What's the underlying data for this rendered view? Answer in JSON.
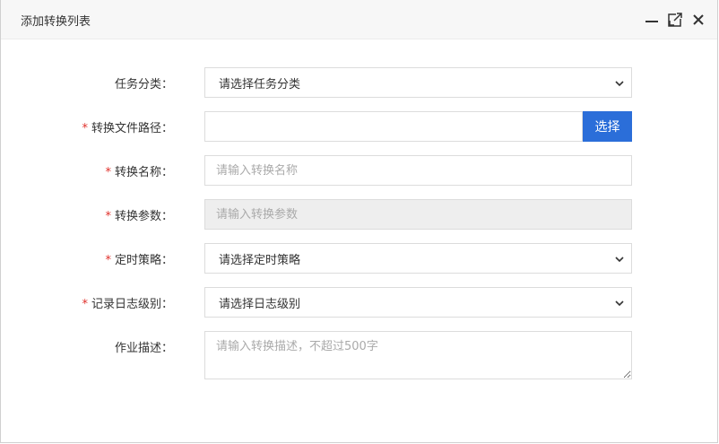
{
  "dialog": {
    "title": "添加转换列表"
  },
  "form": {
    "task_category": {
      "label": "任务分类：",
      "required": false,
      "value": "请选择任务分类"
    },
    "file_path": {
      "label": "转换文件路径：",
      "required": true,
      "value": "",
      "button": "选择"
    },
    "name": {
      "label": "转换名称：",
      "required": true,
      "placeholder": "请输入转换名称"
    },
    "params": {
      "label": "转换参数：",
      "required": true,
      "placeholder": "请输入转换参数"
    },
    "strategy": {
      "label": "定时策略：",
      "required": true,
      "value": "请选择定时策略"
    },
    "log_level": {
      "label": "记录日志级别：",
      "required": true,
      "value": "请选择日志级别"
    },
    "description": {
      "label": "作业描述：",
      "required": false,
      "placeholder": "请输入转换描述，不超过500字"
    }
  },
  "required_mark": "*",
  "colors": {
    "primary": "#2b6ed9",
    "required": "#e0302b",
    "disabled_bg": "#eeeeee"
  }
}
